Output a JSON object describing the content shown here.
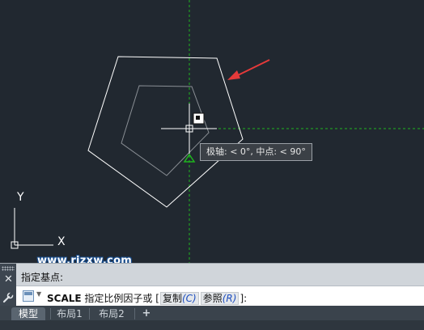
{
  "viewport": {
    "background_color": "#212830",
    "axis_labels": {
      "y": "Y",
      "x": "X"
    },
    "tooltip": "极轴: < 0°,  中点: < 90°",
    "colors": {
      "geometry": "#ffffff",
      "inner_geometry": "#8a8f95",
      "crosshair": "#ffffff",
      "tracking_line": "#1fb31f",
      "arrow": "#e53a3a"
    }
  },
  "watermark": {
    "text": "www.rjzxw.com"
  },
  "command_window": {
    "history_line": "指定基点:",
    "prompt": {
      "command": "SCALE",
      "text": "指定比例因子或",
      "open_bracket": "[",
      "options": [
        {
          "label": "复制",
          "key": "(C)"
        },
        {
          "label": "参照",
          "key": "(R)"
        }
      ],
      "close_bracket": "]:"
    },
    "icons": [
      "close-icon",
      "wrench-icon",
      "command-icon"
    ]
  },
  "layout_tabs": {
    "tabs": [
      {
        "label": "模型",
        "active": true
      },
      {
        "label": "布局1",
        "active": false
      },
      {
        "label": "布局2",
        "active": false
      }
    ],
    "add_label": "+"
  }
}
